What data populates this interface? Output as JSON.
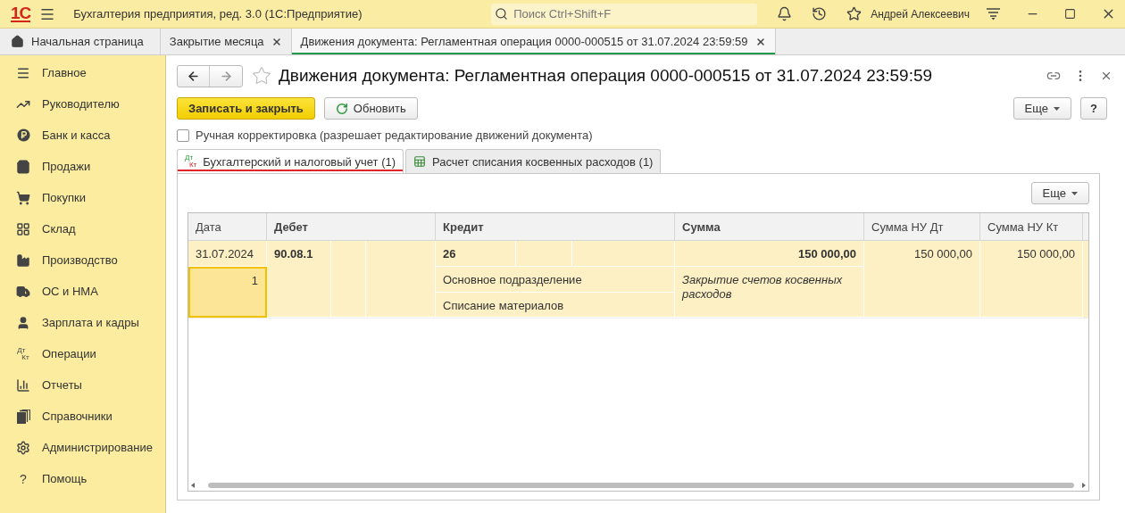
{
  "app_bar": {
    "logo": "1С",
    "title": "Бухгалтерия предприятия, ред. 3.0  (1С:Предприятие)",
    "search": {
      "placeholder": "Поиск Ctrl+Shift+F"
    },
    "user": "Андрей Алексеевич"
  },
  "open_tabs": [
    {
      "label": "Начальная страница",
      "kind": "home",
      "selected": false
    },
    {
      "label": "Закрытие месяца",
      "kind": "closable",
      "selected": false
    },
    {
      "label": "Движения документа: Регламентная операция 0000-000515 от 31.07.2024 23:59:59",
      "kind": "closable",
      "selected": true
    }
  ],
  "sidebar": {
    "items": [
      {
        "label": "Главное"
      },
      {
        "label": "Руководителю"
      },
      {
        "label": "Банк и касса"
      },
      {
        "label": "Продажи"
      },
      {
        "label": "Покупки"
      },
      {
        "label": "Склад"
      },
      {
        "label": "Производство"
      },
      {
        "label": "ОС и НМА"
      },
      {
        "label": "Зарплата и кадры"
      },
      {
        "label": "Операции",
        "icon_text": [
          "Дт",
          "Кт"
        ]
      },
      {
        "label": "Отчеты"
      },
      {
        "label": "Справочники"
      },
      {
        "label": "Администрирование"
      },
      {
        "label": "Помощь",
        "icon_char": "?"
      }
    ]
  },
  "form": {
    "title": "Движения документа: Регламентная операция 0000-000515 от 31.07.2024 23:59:59",
    "buttons": {
      "save": "Записать и закрыть",
      "refresh": "Обновить",
      "more": "Еще",
      "help": "?"
    },
    "manual_edit": {
      "label": "Ручная корректировка (разрешает редактирование движений документа)",
      "checked": false
    },
    "tabs": [
      {
        "label": "Бухгалтерский и налоговый учет (1)",
        "icon_text": [
          "Дт",
          "Кт"
        ],
        "selected": true
      },
      {
        "label": "Расчет списания косвенных расходов (1)",
        "selected": false
      }
    ],
    "panel_more": "Еще",
    "table": {
      "columns": [
        {
          "label": "Дата",
          "bold": false
        },
        {
          "label": "Дебет",
          "bold": true
        },
        {
          "label": "Кредит",
          "bold": true
        },
        {
          "label": "Сумма",
          "bold": true
        },
        {
          "label": "Сумма НУ Дт",
          "bold": false
        },
        {
          "label": "Сумма НУ Кт",
          "bold": false
        }
      ],
      "rows": [
        {
          "date": "31.07.2024",
          "number": "1",
          "number_selected": true,
          "debit": "90.08.1",
          "credit": "26",
          "credit_subconto": [
            "Основное подразделение",
            "Списание материалов"
          ],
          "amount": "150 000,00",
          "content": "Закрытие счетов косвенных расходов",
          "amount_nu_dt": "150 000,00",
          "amount_nu_kt": "150 000,00"
        }
      ]
    }
  }
}
